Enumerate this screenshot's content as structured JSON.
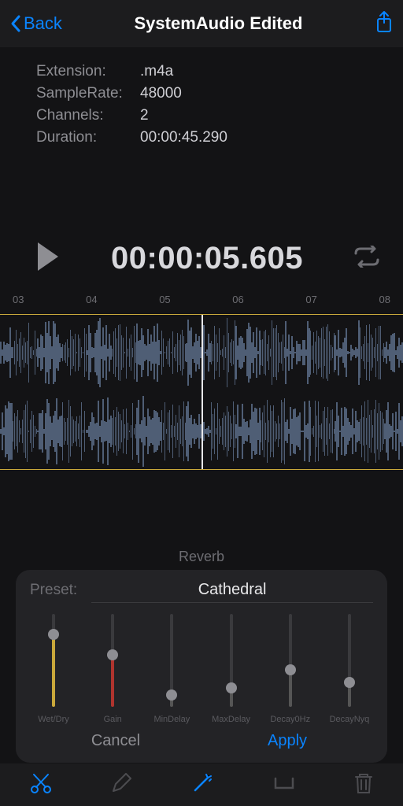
{
  "nav": {
    "back": "Back",
    "title": "SystemAudio Edited"
  },
  "info": {
    "ext_label": "Extension:",
    "ext": ".m4a",
    "rate_label": "SampleRate:",
    "rate": "48000",
    "ch_label": "Channels:",
    "ch": "2",
    "dur_label": "Duration:",
    "dur": "00:00:45.290"
  },
  "player": {
    "time": "00:00:05.605"
  },
  "ticks": [
    "03",
    "04",
    "05",
    "06",
    "07",
    "08"
  ],
  "effect": {
    "name": "Reverb",
    "preset_label": "Preset:",
    "preset": "Cathedral",
    "sliders": [
      {
        "label": "Wet/Dry",
        "value": 0.78,
        "color": "#c9a83b"
      },
      {
        "label": "Gain",
        "value": 0.56,
        "color": "#b0342e"
      },
      {
        "label": "MinDelay",
        "value": 0.13,
        "color": "#555"
      },
      {
        "label": "MaxDelay",
        "value": 0.2,
        "color": "#555"
      },
      {
        "label": "Decay0Hz",
        "value": 0.4,
        "color": "#555"
      },
      {
        "label": "DecayNyq",
        "value": 0.26,
        "color": "#555"
      }
    ],
    "cancel": "Cancel",
    "apply": "Apply"
  }
}
